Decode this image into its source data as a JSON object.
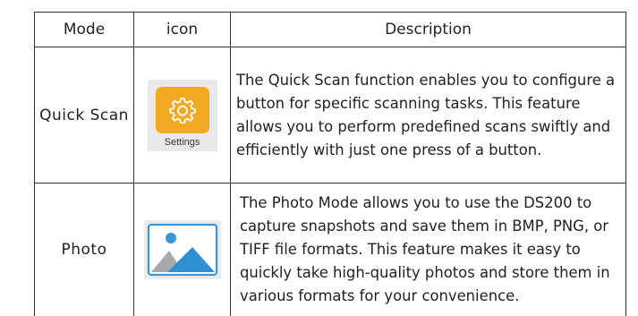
{
  "table": {
    "headers": {
      "mode": "Mode",
      "icon": "icon",
      "description": "Description"
    },
    "rows": [
      {
        "mode": "Quick Scan",
        "icon": {
          "name": "settings-icon",
          "label": "Settings",
          "color": "#f2a922"
        },
        "description": "The Quick Scan function enables you to configure a button for specific scanning tasks. This feature allows you to perform predefined scans swiftly and efficiently with just one press of a button."
      },
      {
        "mode": "Photo",
        "icon": {
          "name": "photo-icon",
          "color": "#3b96d6"
        },
        "description": "The Photo Mode allows you to use the DS200 to capture snapshots and save them in BMP, PNG, or TIFF file formats. This feature makes it easy to quickly take high-quality photos and store them in various formats for your convenience."
      }
    ]
  }
}
